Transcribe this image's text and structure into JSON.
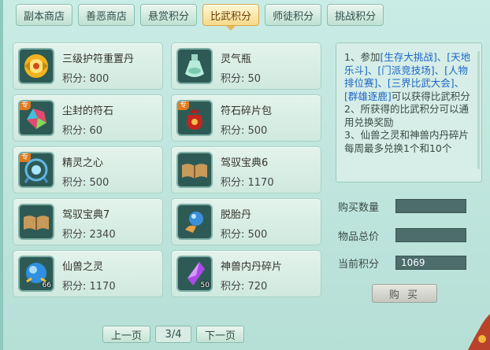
{
  "tabs": [
    {
      "label": "副本商店"
    },
    {
      "label": "善恶商店"
    },
    {
      "label": "悬赏积分"
    },
    {
      "label": "比武积分",
      "active": true
    },
    {
      "label": "师徒积分"
    },
    {
      "label": "挑战积分"
    }
  ],
  "items": [
    {
      "name": "三级护符重置丹",
      "price": "积分: 800",
      "icon": "golden-amulet-icon"
    },
    {
      "name": "灵气瓶",
      "price": "积分: 50",
      "icon": "jade-bottle-icon"
    },
    {
      "name": "尘封的符石",
      "price": "积分: 60",
      "badge": "专",
      "icon": "rune-stone-icon"
    },
    {
      "name": "符石碎片包",
      "price": "积分: 500",
      "badge": "专",
      "icon": "red-pouch-icon"
    },
    {
      "name": "精灵之心",
      "price": "积分: 500",
      "badge": "专",
      "icon": "spirit-heart-icon"
    },
    {
      "name": "驾驭宝典6",
      "price": "积分: 1170",
      "icon": "book-icon"
    },
    {
      "name": "驾驭宝典7",
      "price": "积分: 2340",
      "icon": "book-icon"
    },
    {
      "name": "脱胎丹",
      "price": "积分: 500",
      "icon": "blue-pill-icon"
    },
    {
      "name": "仙兽之灵",
      "price": "积分: 1170",
      "count": "66",
      "icon": "blue-orb-icon"
    },
    {
      "name": "神兽内丹碎片",
      "price": "积分: 720",
      "count": "50",
      "icon": "purple-crystal-icon"
    }
  ],
  "pager": {
    "prev": "上一页",
    "page": "3/4",
    "next": "下一页"
  },
  "info": {
    "l1a": "1、参加",
    "l1b": "[生存大挑战]、[天地乐斗]、[门派竞技场]、[人物排位赛]、[三界比武大会]、[群雄逐鹿]",
    "l1c": "可以获得比武积分",
    "l2": "2、所获得的比武积分可以通用兑换奖励",
    "l3": "3、仙兽之灵和神兽内丹碎片每周最多兑换1个和10个"
  },
  "purchase": {
    "qty_label": "购买数量",
    "qty_value": "",
    "total_label": "物品总价",
    "total_value": "",
    "points_label": "当前积分",
    "points_value": "1069",
    "buy_label": "购 买"
  }
}
